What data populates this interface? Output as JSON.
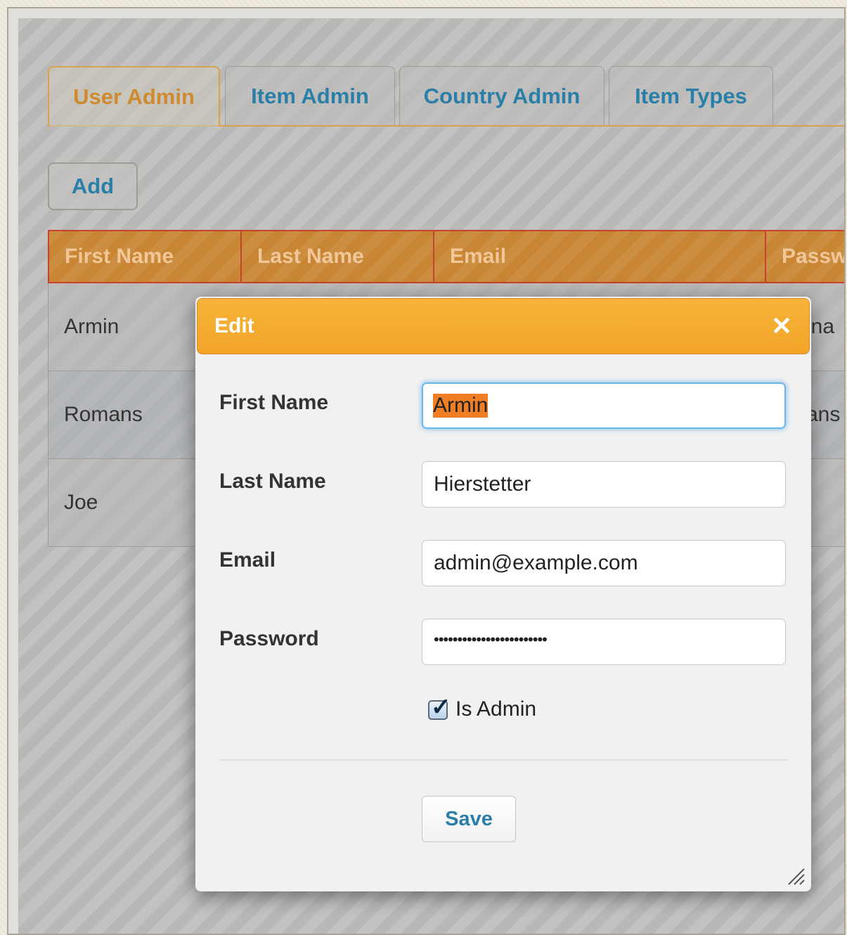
{
  "tabs": [
    {
      "label": "User Admin",
      "active": true
    },
    {
      "label": "Item Admin"
    },
    {
      "label": "Country Admin"
    },
    {
      "label": "Item Types"
    }
  ],
  "toolbar": {
    "add_label": "Add"
  },
  "table": {
    "columns": [
      "First Name",
      "Last Name",
      "Email",
      "Passw"
    ],
    "rows": [
      {
        "first_name": "Armin",
        "password_partial": "ina"
      },
      {
        "first_name": "Romans",
        "password_partial": "ans"
      },
      {
        "first_name": "Joe"
      }
    ]
  },
  "dialog": {
    "title": "Edit",
    "close_icon": "close-icon",
    "fields": {
      "first_name": {
        "label": "First Name",
        "value": "Armin"
      },
      "last_name": {
        "label": "Last Name",
        "value": "Hierstetter"
      },
      "email": {
        "label": "Email",
        "value": "admin@example.com"
      },
      "password": {
        "label": "Password",
        "value": "••••••••••••••••••••••••"
      }
    },
    "is_admin": {
      "label": "Is Admin",
      "checked": true
    },
    "save_label": "Save"
  },
  "colors": {
    "accent_orange": "#f2a428",
    "header_orange": "#c88533",
    "link_blue": "#2a7fa8",
    "active_tab_text": "#cf8a2d",
    "selection": "#f07e25"
  }
}
